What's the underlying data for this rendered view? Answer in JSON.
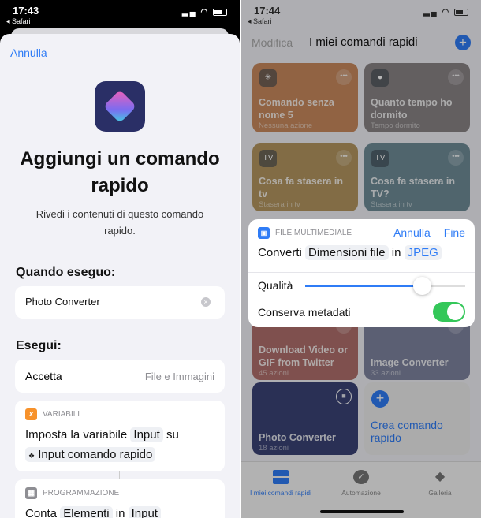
{
  "left": {
    "status": {
      "time": "17:43",
      "back": "◂ Safari"
    },
    "cancel": "Annulla",
    "title": "Aggiungi un comando rapido",
    "subtitle": "Rivedi i contenuti di questo comando rapido.",
    "when_label": "Quando eseguo:",
    "name_field": "Photo Converter",
    "run_label": "Esegui:",
    "accept": {
      "label": "Accetta",
      "value": "File e Immagini"
    },
    "actions": [
      {
        "category": "VARIABILI",
        "icon": "x",
        "color": "#f7922b",
        "text1": "Imposta la variabile",
        "pill1": "Input",
        "text2": "su",
        "pill2": "Input comando rapido"
      },
      {
        "category": "PROGRAMMAZIONE",
        "icon": "calculator-icon",
        "color": "#8e8e93",
        "text1": "Conta",
        "pill1": "Elementi",
        "text2": "in",
        "pill2": "Input"
      }
    ]
  },
  "right": {
    "status": {
      "time": "17:44",
      "back": "◂ Safari"
    },
    "nav": {
      "edit": "Modifica",
      "title": "I miei comandi rapidi"
    },
    "tiles": [
      {
        "title": "Comando senza nome 5",
        "sub": "Nessuna azione",
        "color": "#c98a5e"
      },
      {
        "title": "Quanto tempo ho dormito",
        "sub": "Tempo dormito",
        "color": "#8a8486"
      },
      {
        "title": "Cosa fa stasera in tv",
        "sub": "Stasera in tv",
        "color": "#b49660"
      },
      {
        "title": "Cosa fa stasera in TV?",
        "sub": "Stasera in tv",
        "color": "#6f8d98"
      },
      {
        "title": "Download Video or GIF from Twitter",
        "sub": "45 azioni",
        "color": "#b0706c"
      },
      {
        "title": "Image Converter",
        "sub": "33 azioni",
        "color": "#7f84a0"
      },
      {
        "title": "Photo Converter",
        "sub": "18 azioni",
        "color": "#3b4377"
      }
    ],
    "create": "Crea comando rapido",
    "popup": {
      "category": "FILE MULTIMEDIALE",
      "cancel": "Annulla",
      "done": "Fine",
      "convert": "Converti",
      "pill1": "Dimensioni file",
      "in": "in",
      "pill2": "JPEG",
      "quality": "Qualità",
      "quality_value": 0.73,
      "keep_meta": "Conserva metadati",
      "keep_meta_on": true
    },
    "tabs": [
      {
        "label": "I miei comandi rapidi",
        "active": true
      },
      {
        "label": "Automazione"
      },
      {
        "label": "Galleria"
      }
    ]
  }
}
